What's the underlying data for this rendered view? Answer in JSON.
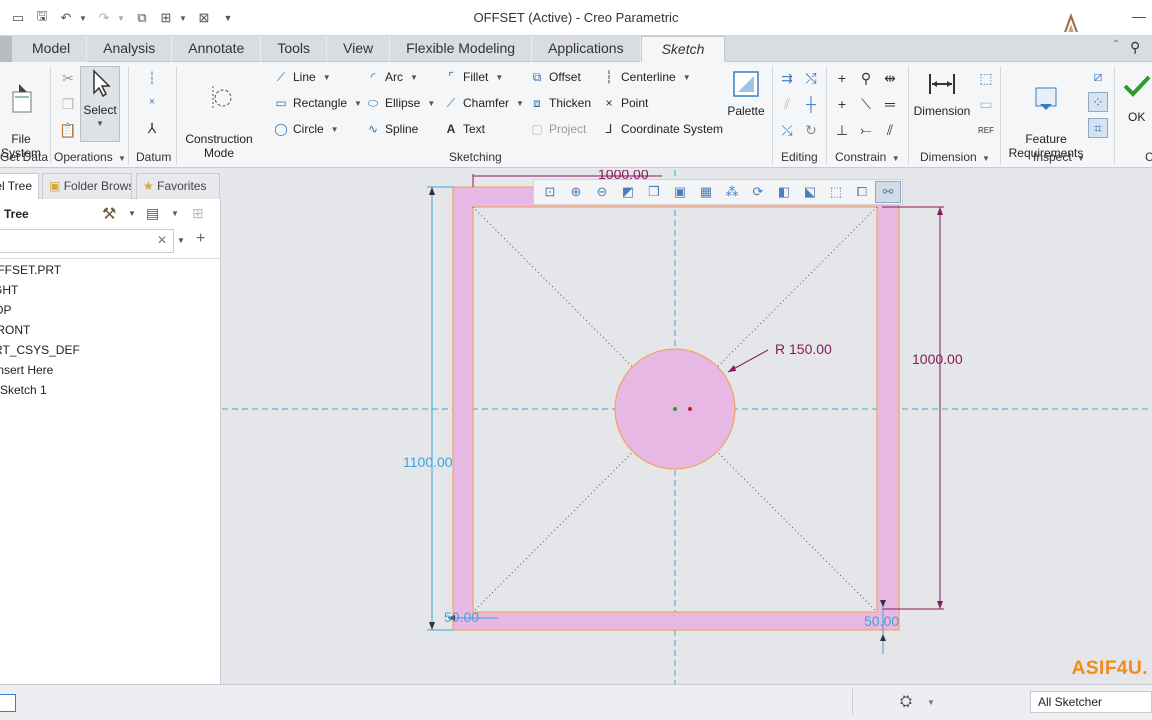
{
  "window": {
    "title": "OFFSET (Active) - Creo Parametric"
  },
  "quick_access": {
    "icons": [
      "new-file-icon",
      "open-icon",
      "save-icon",
      "undo-icon",
      "redo-icon",
      "regenerate-icon",
      "windows-icon",
      "close-window-icon",
      "customize-icon"
    ]
  },
  "tabs": [
    {
      "label": "Model",
      "active": false
    },
    {
      "label": "Analysis",
      "active": false
    },
    {
      "label": "Annotate",
      "active": false
    },
    {
      "label": "Tools",
      "active": false
    },
    {
      "label": "View",
      "active": false
    },
    {
      "label": "Flexible Modeling",
      "active": false
    },
    {
      "label": "Applications",
      "active": false
    },
    {
      "label": "Sketch",
      "active": true
    }
  ],
  "ribbon": {
    "get_data": {
      "file_system": "File\nSystem",
      "label": "Get Data"
    },
    "operations": {
      "select": "Select",
      "label": "Operations"
    },
    "datum": {
      "label": "Datum"
    },
    "sketching": {
      "construction_mode": "Construction\nMode",
      "line": "Line",
      "rectangle": "Rectangle",
      "circle": "Circle",
      "arc": "Arc",
      "ellipse": "Ellipse",
      "spline": "Spline",
      "fillet": "Fillet",
      "chamfer": "Chamfer",
      "text": "Text",
      "offset": "Offset",
      "thicken": "Thicken",
      "project": "Project",
      "centerline": "Centerline",
      "point": "Point",
      "coordinate_system": "Coordinate System",
      "palette": "Palette",
      "label": "Sketching"
    },
    "editing": {
      "label": "Editing"
    },
    "constrain": {
      "label": "Constrain"
    },
    "dimension": {
      "button": "Dimension",
      "label": "Dimension"
    },
    "inspect": {
      "feature_requirements": "Feature\nRequirements",
      "label": "Inspect"
    },
    "close": {
      "ok": "OK"
    }
  },
  "left_panel": {
    "tabs": [
      "Model Tree",
      "Folder Browser",
      "Favorites"
    ],
    "header": "Model Tree",
    "tree_items": [
      "OFFSET.PRT",
      "RIGHT",
      "TOP",
      "FRONT",
      "PRT_CSYS_DEF",
      "Insert Here",
      "Sketch 1"
    ]
  },
  "canvas": {
    "dimensions": {
      "top_width": "1000.00",
      "radius": "R 150.00",
      "right_height": "1000.00",
      "left_height": "1100.00",
      "thickness_left": "50.00",
      "thickness_bottom": "50.00"
    },
    "watermark": "ASIF4U."
  },
  "status_bar": {
    "filter": "All Sketcher"
  },
  "colors": {
    "fill": "#e8b8e4",
    "edge": "#f0a040",
    "dimension_blue": "#3aa6d8",
    "dimension_strong": "#8a1a5a",
    "axis": "#3fa7c9",
    "ok_green": "#2e9a2e"
  }
}
